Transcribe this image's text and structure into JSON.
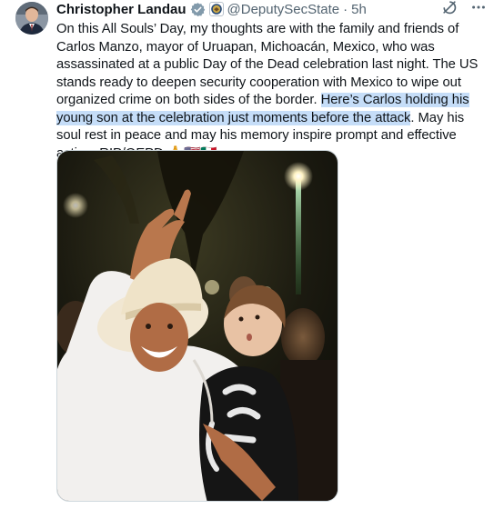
{
  "tweet": {
    "author_name": "Christopher Landau",
    "handle": "@DeputySecState",
    "separator": "·",
    "timestamp": "5h",
    "icons": {
      "verified": "gray-verified-badge-icon",
      "affiliation": "us-state-department-seal-icon",
      "more": "more-options-icon",
      "grok": "grok-icon"
    },
    "text_part1": "On this All Souls’ Day, my thoughts are with the family and friends of Carlos Manzo, mayor of Uruapan, Michoacán, Mexico, who was assassinated at a public Day of the Dead celebration last night. The US stands ready to deepen security cooperation with Mexico to wipe out organized crime on both sides of the border. ",
    "text_highlighted": "Here’s Carlos holding his young son at the celebration just moments before the attack",
    "text_part2": ". May his soul rest in peace and may his memory inspire prompt and effective action. RIP/QEPD ",
    "emojis": "🙏🇺🇸🇲🇽",
    "media": {
      "type": "photo",
      "depicts": "man-in-white-cowboy-hat-holding-child-pointing-up-photo"
    }
  }
}
